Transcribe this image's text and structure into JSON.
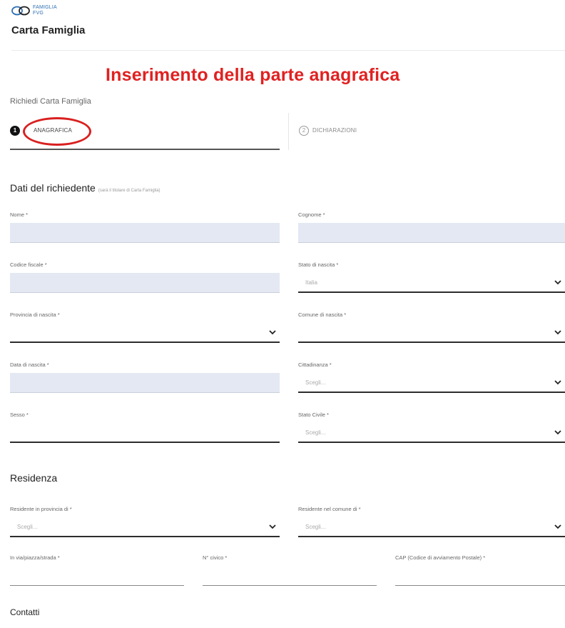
{
  "header": {
    "logo_line1": "Famiglia",
    "logo_line2": "FVG",
    "app_title": "Carta Famiglia"
  },
  "annotation": {
    "title": "Inserimento della parte anagrafica"
  },
  "breadcrumb": "Richiedi Carta Famiglia",
  "stepper": {
    "steps": [
      {
        "number": "1",
        "label": "ANAGRAFICA"
      },
      {
        "number": "2",
        "label": "DICHIARAZIONI"
      }
    ]
  },
  "applicant": {
    "title": "Dati del richiedente",
    "note": "(sarà il titolare di Carta Famiglia)",
    "fields": {
      "nome": {
        "label": "Nome *"
      },
      "cognome": {
        "label": "Cognome *"
      },
      "codice_fiscale": {
        "label": "Codice fiscale *"
      },
      "stato_nascita": {
        "label": "Stato di nascita *",
        "value": "Italia"
      },
      "provincia_nascita": {
        "label": "Provincia di nascita *"
      },
      "comune_nascita": {
        "label": "Comune di nascita *"
      },
      "data_nascita": {
        "label": "Data di nascita *"
      },
      "cittadinanza": {
        "label": "Cittadinanza *",
        "placeholder": "Scegli..."
      },
      "sesso": {
        "label": "Sesso *"
      },
      "stato_civile": {
        "label": "Stato Civile *",
        "placeholder": "Scegli..."
      }
    }
  },
  "residence": {
    "title": "Residenza",
    "fields": {
      "provincia": {
        "label": "Residente in provincia di *",
        "placeholder": "Scegli..."
      },
      "comune": {
        "label": "Residente nel comune di *",
        "placeholder": "Scegli..."
      },
      "via": {
        "label": "In via/piazza/strada *"
      },
      "civico": {
        "label": "N° civico *"
      },
      "cap": {
        "label": "CAP (Codice di avviamento Postale) *"
      }
    }
  },
  "contacts": {
    "title": "Contatti"
  },
  "icons": {
    "logo": "family-logo-icon",
    "chevron": "chevron-down-icon"
  },
  "colors": {
    "annotation_red": "#e02121",
    "filled_field": "#e3e8f2",
    "brand_blue": "#2f6fb1"
  }
}
